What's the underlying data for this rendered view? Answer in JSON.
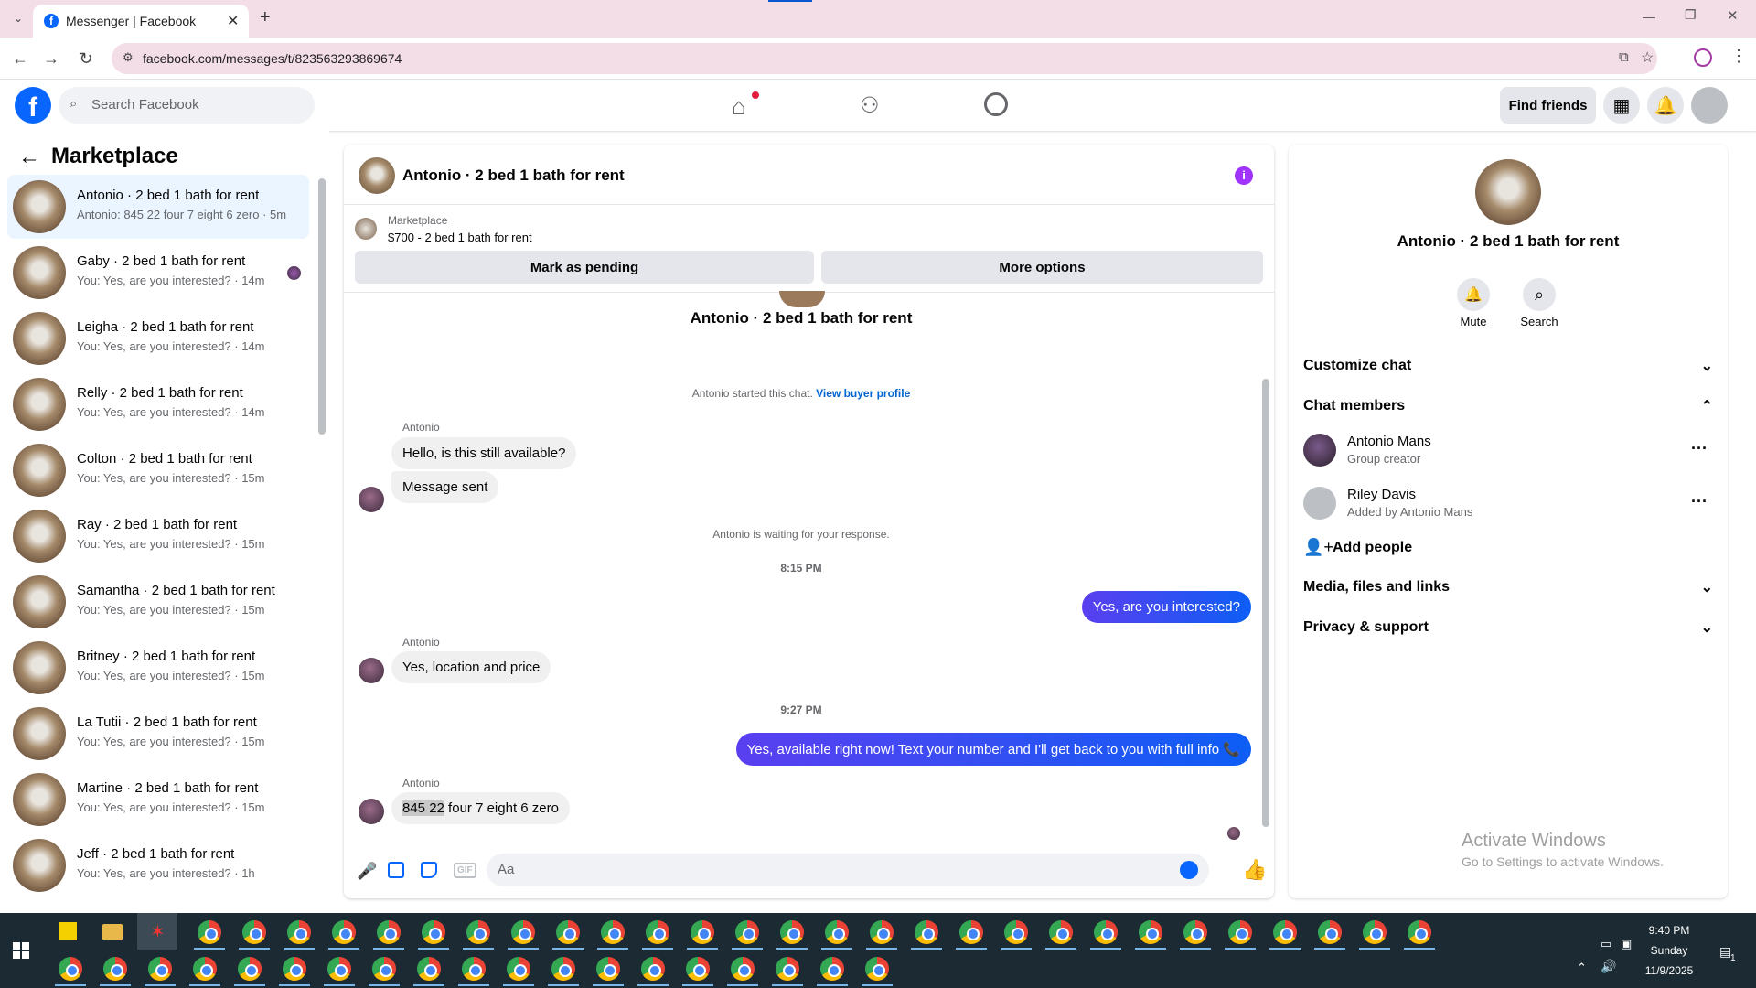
{
  "browser": {
    "tab_title": "Messenger | Facebook",
    "url": "facebook.com/messages/t/823563293869674"
  },
  "fb_header": {
    "search_placeholder": "Search Facebook",
    "find_friends": "Find friends"
  },
  "left": {
    "title": "Marketplace",
    "conversations": [
      {
        "name": "Antonio · 2 bed 1 bath for rent",
        "preview": "Antonio: 845 22 four 7 eight 6 zero · 5m"
      },
      {
        "name": "Gaby · 2 bed 1 bath for rent",
        "preview": "You: Yes, are you interested? · 14m"
      },
      {
        "name": "Leigha · 2 bed 1 bath for rent",
        "preview": "You: Yes, are you interested? · 14m"
      },
      {
        "name": "Relly · 2 bed 1 bath for rent",
        "preview": "You: Yes, are you interested? · 14m"
      },
      {
        "name": "Colton · 2 bed 1 bath for rent",
        "preview": "You: Yes, are you interested? · 15m"
      },
      {
        "name": "Ray · 2 bed 1 bath for rent",
        "preview": "You: Yes, are you interested? · 15m"
      },
      {
        "name": "Samantha · 2 bed 1 bath for rent",
        "preview": "You: Yes, are you interested? · 15m"
      },
      {
        "name": "Britney · 2 bed 1 bath for rent",
        "preview": "You: Yes, are you interested? · 15m"
      },
      {
        "name": "La Tutii · 2 bed 1 bath for rent",
        "preview": "You: Yes, are you interested? · 15m"
      },
      {
        "name": "Martine · 2 bed 1 bath for rent",
        "preview": "You: Yes, are you interested? · 15m"
      },
      {
        "name": "Jeff · 2 bed 1 bath for rent",
        "preview": "You: Yes, are you interested? · 1h"
      }
    ]
  },
  "chat": {
    "title": "Antonio · 2 bed 1 bath for rent",
    "listing_source": "Marketplace",
    "listing_price": "$700 - 2 bed 1 bath for rent",
    "mark_pending": "Mark as pending",
    "more_options": "More options",
    "intro_name": "Antonio · 2 bed 1 bath for rent",
    "started_text": "Antonio started this chat.",
    "view_buyer": "View buyer profile",
    "sender": "Antonio",
    "msg1": "Hello, is this still available?",
    "msg2": "Message sent",
    "waiting": "Antonio is waiting for your response.",
    "time1": "8:15 PM",
    "out1": "Yes, are you interested?",
    "msg3": "Yes, location and price",
    "time2": "9:27 PM",
    "out2": "Yes, available right now! Text your number and I'll get back to you with full info 📞",
    "msg4_highlight": "845 22",
    "msg4_rest": " four 7 eight 6 zero",
    "composer_placeholder": "Aa"
  },
  "right": {
    "name": "Antonio · 2 bed 1 bath for rent",
    "mute": "Mute",
    "search": "Search",
    "customize": "Customize chat",
    "members_header": "Chat members",
    "members": [
      {
        "name": "Antonio Mans",
        "sub": "Group creator"
      },
      {
        "name": "Riley Davis",
        "sub": "Added by Antonio Mans"
      }
    ],
    "add_people": "Add people",
    "media": "Media, files and links",
    "privacy": "Privacy & support"
  },
  "watermark": {
    "line1": "Activate Windows",
    "line2": "Go to Settings to activate Windows."
  },
  "tray": {
    "time": "9:40 PM",
    "day": "Sunday",
    "date": "11/9/2025",
    "notif_count": "1"
  },
  "colors": {
    "accent": "#0866ff",
    "outgoing": "#3d3df5",
    "tab_bg": "#f3dde6"
  }
}
